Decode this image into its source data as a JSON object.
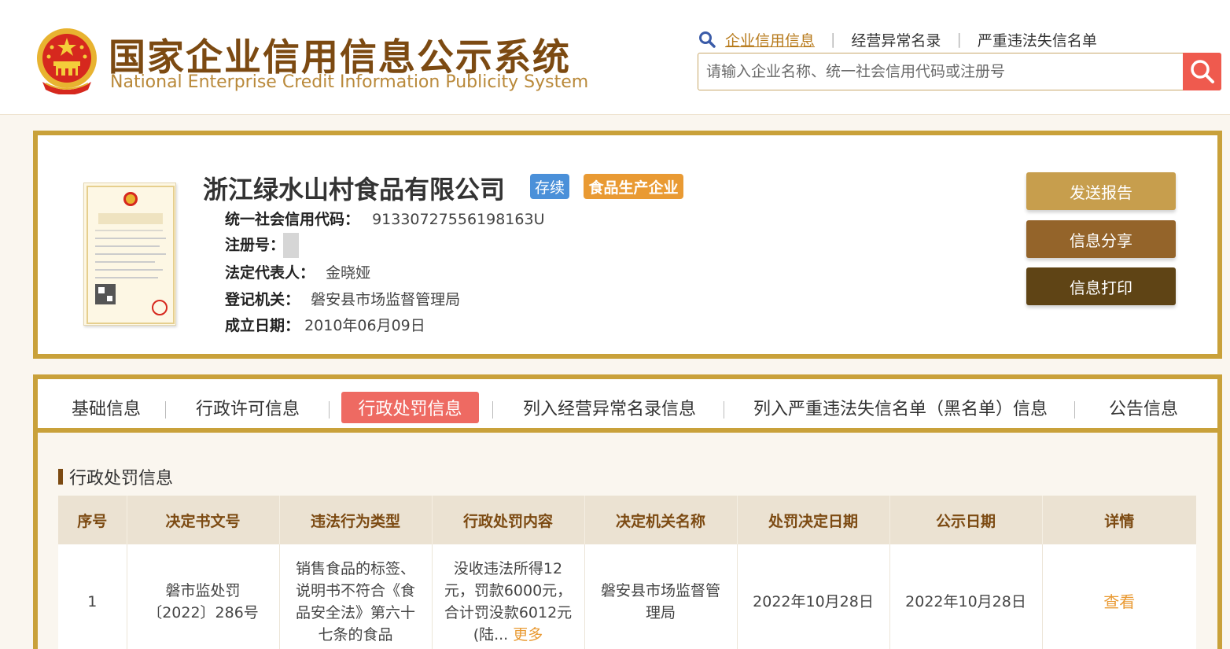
{
  "header": {
    "title_cn": "国家企业信用信息公示系统",
    "title_en": "National Enterprise Credit Information Publicity System",
    "nav": [
      {
        "label": "企业信用信息",
        "active": true
      },
      {
        "label": "经营异常名录",
        "active": false
      },
      {
        "label": "严重违法失信名单",
        "active": false
      }
    ],
    "search_placeholder": "请输入企业名称、统一社会信用代码或注册号"
  },
  "company": {
    "name": "浙江绿水山村食品有限公司",
    "status_badge": "存续",
    "type_badge": "食品生产企业",
    "license_title": "营业执照",
    "fields": {
      "credit_code_label": "统一社会信用代码：",
      "credit_code_value": "91330727556198163U",
      "reg_no_label": "注册号：",
      "reg_no_value": "",
      "legal_rep_label": "法定代表人：",
      "legal_rep_value": "金晓娅",
      "authority_label": "登记机关：",
      "authority_value": "磐安县市场监督管理局",
      "established_label": "成立日期：",
      "established_value": "2010年06月09日"
    },
    "actions": {
      "send_report": "发送报告",
      "share": "信息分享",
      "print": "信息打印"
    }
  },
  "tabs": [
    {
      "label": "基础信息",
      "active": false
    },
    {
      "label": "行政许可信息",
      "active": false
    },
    {
      "label": "行政处罚信息",
      "active": true
    },
    {
      "label": "列入经营异常名录信息",
      "active": false
    },
    {
      "label": "列入严重违法失信名单（黑名单）信息",
      "active": false
    },
    {
      "label": "公告信息",
      "active": false
    }
  ],
  "section": {
    "title": "行政处罚信息",
    "table": {
      "columns": [
        "序号",
        "决定书文号",
        "违法行为类型",
        "行政处罚内容",
        "决定机关名称",
        "处罚决定日期",
        "公示日期",
        "详情"
      ],
      "rows": [
        {
          "index": "1",
          "doc_no": "磐市监处罚〔2022〕286号",
          "violation": "销售食品的标签、说明书不符合《食品安全法》第六十七条的食品",
          "content": "没收违法所得12元，罚款6000元，合计罚没款6012元(陆...",
          "content_more": "更多",
          "authority": "磐安县市场监督管理局",
          "decision_date": "2022年10月28日",
          "publish_date": "2022年10月28日",
          "detail": "查看"
        }
      ]
    }
  },
  "colors": {
    "gold_border": "#c9a13a",
    "brown_text": "#7c4a12",
    "active_tab": "#ee6a62",
    "search_button": "#ef5a4e",
    "status_blue": "#4a90d9",
    "type_orange": "#e99a33"
  },
  "icons": {
    "emblem": "national-emblem-icon",
    "search_small": "search-icon",
    "search_button": "search-icon",
    "license": "business-license-icon"
  }
}
